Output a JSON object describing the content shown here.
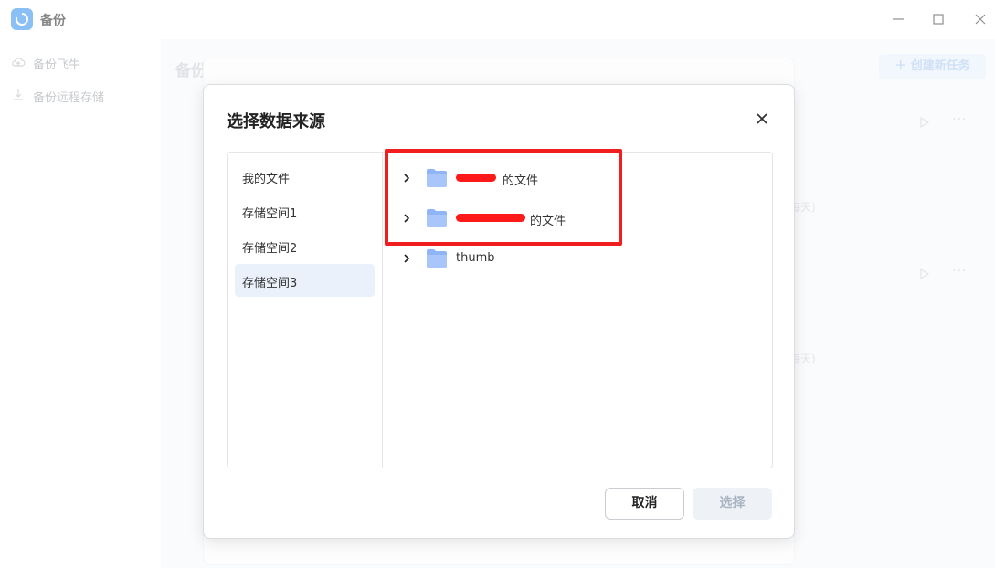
{
  "window": {
    "title": "备份",
    "icon": "backup-sync-icon",
    "controls": [
      "minimize-icon",
      "maximize-icon",
      "close-icon"
    ]
  },
  "sidebar": {
    "items": [
      {
        "label": "备份飞牛",
        "icon": "cloud-upload-icon"
      },
      {
        "label": "备份远程存储",
        "icon": "download-icon"
      }
    ]
  },
  "main": {
    "title": "备份",
    "create_button": "＋ 创建新任务",
    "task_suffix": "每天)"
  },
  "dialog": {
    "title": "选择数据来源",
    "locations": [
      {
        "label": "我的文件",
        "selected": false
      },
      {
        "label": "存储空间1",
        "selected": false
      },
      {
        "label": "存储空间2",
        "selected": false
      },
      {
        "label": "存储空间3",
        "selected": true
      }
    ],
    "folders": [
      {
        "name": "的文件",
        "redacted": true
      },
      {
        "name": "的文件",
        "redacted": true
      },
      {
        "name": "thumb",
        "redacted": false
      }
    ],
    "cancel_label": "取消",
    "select_label": "选择"
  },
  "colors": {
    "accent": "#2d8cf0",
    "highlight": "#f01e1e",
    "folder": "#8fb4f7",
    "selected_bg": "#eaf1fb"
  }
}
